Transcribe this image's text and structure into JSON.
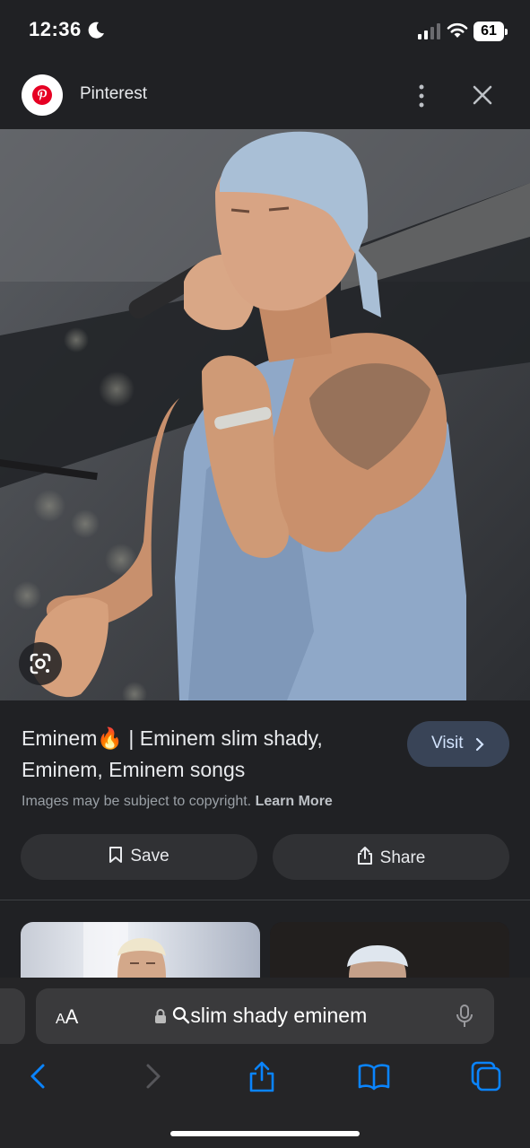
{
  "status_bar": {
    "time": "12:36",
    "battery": "61",
    "icons": [
      "moon-icon",
      "signal-icon",
      "wifi-icon",
      "battery-icon"
    ]
  },
  "header": {
    "site_name": "Pinterest",
    "logo_icon": "pinterest-logo",
    "more_icon": "more-vert-icon",
    "close_icon": "close-icon"
  },
  "result": {
    "title": "Eminem🔥 | Eminem slim shady, Eminem, Eminem songs",
    "visit_label": "Visit",
    "copyright_text": "Images may be subject to copyright.",
    "learn_more": "Learn More",
    "save_label": "Save",
    "share_label": "Share"
  },
  "browser": {
    "aa_big": "A",
    "aa_small": "A",
    "url": "slim shady eminem",
    "icons": [
      "lock-icon",
      "search-icon",
      "mic-icon",
      "back-icon",
      "forward-icon",
      "share-icon",
      "bookmarks-icon",
      "tabs-icon"
    ]
  },
  "colors": {
    "background": "#202124",
    "visit_button": "#394457",
    "accent": "#0a84ff",
    "pinterest_red": "#e60023"
  }
}
